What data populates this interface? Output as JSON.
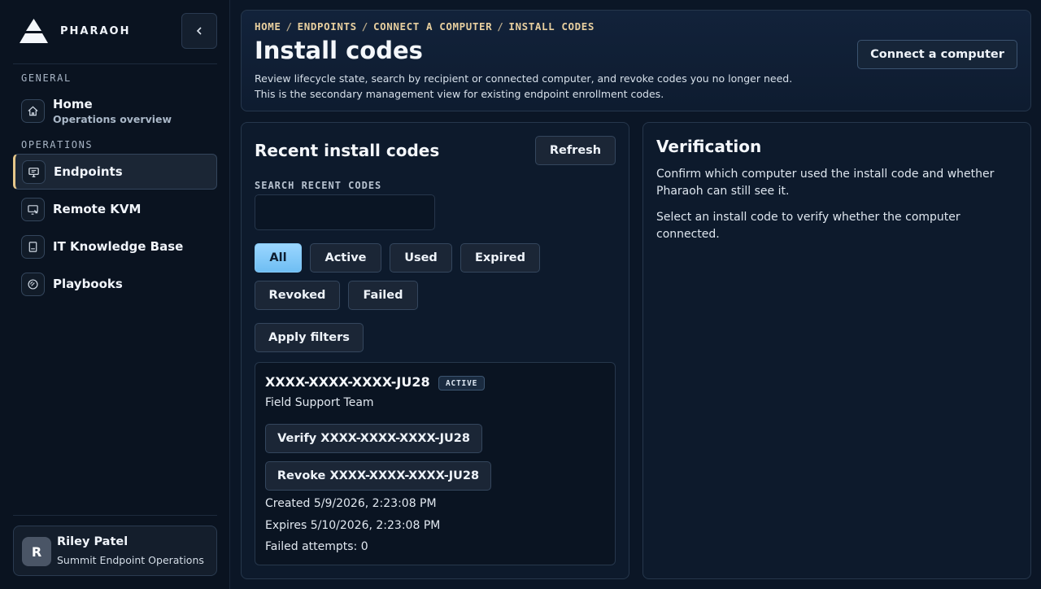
{
  "sidebar": {
    "brand": "PHARAOH",
    "collapse_icon": "chevron-left-icon",
    "sections": [
      {
        "label": "GENERAL"
      },
      {
        "label": "OPERATIONS"
      }
    ],
    "items": [
      {
        "label": "Home",
        "sublabel": "Operations overview",
        "icon": "home-icon"
      },
      {
        "label": "Endpoints",
        "icon": "monitor-icon",
        "active": true
      },
      {
        "label": "Remote KVM",
        "icon": "remote-screen-icon"
      },
      {
        "label": "IT Knowledge Base",
        "icon": "book-icon"
      },
      {
        "label": "Playbooks",
        "icon": "gauge-icon"
      }
    ],
    "user": {
      "initial": "R",
      "name": "Riley Patel",
      "org": "Summit Endpoint Operations"
    }
  },
  "header": {
    "breadcrumb": [
      "HOME",
      "ENDPOINTS",
      "CONNECT A COMPUTER",
      "INSTALL CODES"
    ],
    "breadcrumb_sep": "/",
    "title": "Install codes",
    "description_1": "Review lifecycle state, search by recipient or connected computer, and revoke codes you no longer need.",
    "description_2": "This is the secondary management view for existing endpoint enrollment codes.",
    "connect_button": "Connect a computer"
  },
  "codes": {
    "title": "Recent install codes",
    "refresh_button": "Refresh",
    "search_label": "SEARCH RECENT CODES",
    "search_value": "",
    "search_placeholder": "",
    "filters": [
      "All",
      "Active",
      "Used",
      "Expired",
      "Revoked",
      "Failed"
    ],
    "active_filter": "All",
    "apply_button": "Apply filters",
    "items": [
      {
        "code": "XXXX-XXXX-XXXX-JU28",
        "status": "ACTIVE",
        "recipient": "Field Support Team",
        "verify_button": "Verify XXXX-XXXX-XXXX-JU28",
        "revoke_button": "Revoke XXXX-XXXX-XXXX-JU28",
        "created": "Created 5/9/2026, 2:23:08 PM",
        "expires": "Expires 5/10/2026, 2:23:08 PM",
        "failed_attempts": "Failed attempts: 0"
      }
    ]
  },
  "verification": {
    "title": "Verification",
    "text_1": "Confirm which computer used the install code and whether Pharaoh can still see it.",
    "text_2": "Select an install code to verify whether the computer connected."
  },
  "colors": {
    "background": "#0b1626",
    "accent_gold": "#e6c78a",
    "primary_blue": "#7cc7fa"
  }
}
